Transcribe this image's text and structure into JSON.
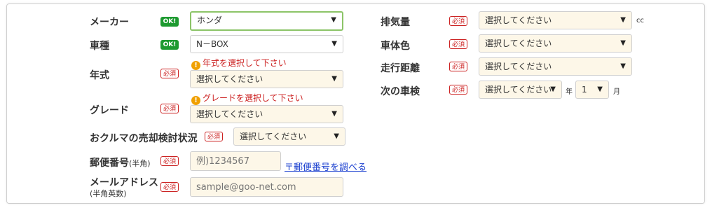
{
  "left": {
    "maker": {
      "label": "メーカー",
      "badge": "OK!",
      "value": "ホンダ"
    },
    "model": {
      "label": "車種",
      "badge": "OK!",
      "value": "N－BOX"
    },
    "year": {
      "label": "年式",
      "badge": "必須",
      "error": "年式を選択して下さい",
      "value": "選択してください"
    },
    "grade": {
      "label": "グレード",
      "badge": "必須",
      "error": "グレードを選択して下さい",
      "value": "選択してください"
    },
    "sale_status": {
      "label": "おクルマの売却検討状況",
      "badge": "必須",
      "value": "選択してください"
    },
    "postal": {
      "label": "郵便番号",
      "label_small": "(半角)",
      "badge": "必須",
      "placeholder": "例)1234567",
      "link_mark": "〒",
      "link": "郵便番号を調べる"
    },
    "email": {
      "label": "メールアドレス",
      "sublabel": "(半角英数)",
      "badge": "必須",
      "placeholder": "sample@goo-net.com"
    }
  },
  "right": {
    "displacement": {
      "label": "排気量",
      "badge": "必須",
      "value": "選択してください",
      "unit": "cc"
    },
    "color": {
      "label": "車体色",
      "badge": "必須",
      "value": "選択してください"
    },
    "mileage": {
      "label": "走行距離",
      "badge": "必須",
      "value": "選択してください"
    },
    "inspection": {
      "label": "次の車検",
      "badge": "必須",
      "value": "選択してください",
      "year_unit": "年",
      "month": "1",
      "month_unit": "月"
    }
  }
}
